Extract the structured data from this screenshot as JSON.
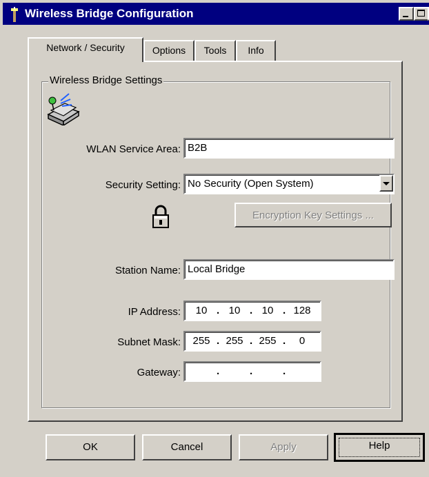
{
  "window": {
    "title": "Wireless Bridge Configuration"
  },
  "tabs": [
    {
      "label": "Network / Security",
      "active": true
    },
    {
      "label": "Options",
      "active": false
    },
    {
      "label": "Tools",
      "active": false
    },
    {
      "label": "Info",
      "active": false
    }
  ],
  "group": {
    "label": "Wireless Bridge Settings"
  },
  "fields": {
    "wlan_label": "WLAN Service Area:",
    "wlan_value": "B2B",
    "security_label": "Security Setting:",
    "security_value": "No Security (Open System)",
    "encryption_button": "Encryption Key Settings ...",
    "station_label": "Station Name:",
    "station_value": "Local Bridge",
    "ip_label": "IP Address:",
    "ip": [
      "10",
      "10",
      "10",
      "128"
    ],
    "subnet_label": "Subnet Mask:",
    "subnet": [
      "255",
      "255",
      "255",
      "0"
    ],
    "gateway_label": "Gateway:",
    "gateway": [
      "",
      "",
      "",
      ""
    ]
  },
  "buttons": {
    "ok": "OK",
    "cancel": "Cancel",
    "apply": "Apply",
    "help": "Help"
  },
  "icons": {
    "app": "antenna-icon",
    "bridge": "wireless-bridge-icon",
    "lock": "padlock-icon"
  },
  "colors": {
    "titlebar": "#000080",
    "face": "#d4d0c8",
    "disabled_text": "#808080"
  }
}
